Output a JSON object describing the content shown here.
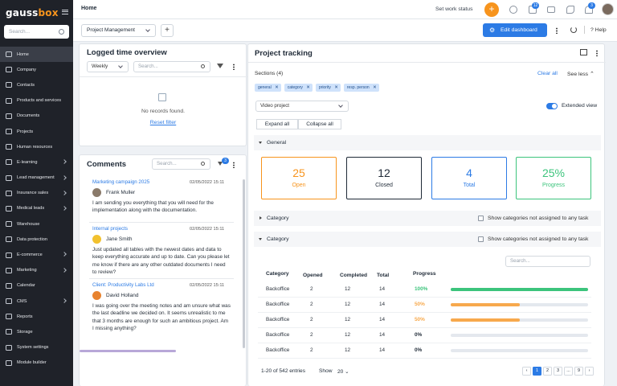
{
  "sidebar": {
    "logo_main": "gauss",
    "logo_accent": "box",
    "search_placeholder": "Search...",
    "items": [
      {
        "label": "Home",
        "active": true,
        "chevron": false
      },
      {
        "label": "Company",
        "chevron": false
      },
      {
        "label": "Contacts",
        "chevron": false
      },
      {
        "label": "Products and services",
        "chevron": false
      },
      {
        "label": "Documents",
        "chevron": false
      },
      {
        "label": "Projects",
        "chevron": false
      },
      {
        "label": "Human resources",
        "chevron": false
      },
      {
        "label": "E-learning",
        "chevron": true
      },
      {
        "label": "Lead management",
        "chevron": true
      },
      {
        "label": "Insurance sales",
        "chevron": true
      },
      {
        "label": "Medical leads",
        "chevron": true
      },
      {
        "label": "Warehouse",
        "chevron": false
      },
      {
        "label": "Data protection",
        "chevron": false
      },
      {
        "label": "E-commerce",
        "chevron": true
      },
      {
        "label": "Marketing",
        "chevron": true
      },
      {
        "label": "Calendar",
        "chevron": false
      },
      {
        "label": "CMS",
        "chevron": true
      },
      {
        "label": "Reports",
        "chevron": false
      },
      {
        "label": "Storage",
        "chevron": false
      },
      {
        "label": "System settings",
        "chevron": false
      },
      {
        "label": "Module builder",
        "chevron": false
      }
    ]
  },
  "topbar": {
    "breadcrumb": "Home",
    "set_work_status": "Set work status",
    "add_symbol": "+",
    "chat_badge": "12",
    "bell_badge": "3",
    "icons": [
      "star-icon",
      "chat-icon",
      "mail-icon",
      "phone-icon",
      "bell-icon"
    ]
  },
  "toolbar": {
    "dashboard_select": "Project Management",
    "add_symbol": "+",
    "edit_dashboard": "Edit dashboard",
    "help": "Help"
  },
  "logged_time": {
    "title": "Logged time overview",
    "period": "Weekly",
    "search_placeholder": "Search...",
    "empty_text": "No records found.",
    "reset_filter": "Reset filter"
  },
  "comments": {
    "title": "Comments",
    "search_placeholder": "Search...",
    "filter_badge": "3",
    "items": [
      {
        "title": "Marketing campaign 2025",
        "date": "02/05/2022 15:11",
        "user": "Frank Muller",
        "avatar_color": "#8a7a6a",
        "text": "I am sending you everything that you will need for the implementation along with the documentation."
      },
      {
        "title": "Internal projects",
        "date": "02/05/2022 15:11",
        "user": "Jane Smith",
        "avatar_color": "#f2c12e",
        "text": "Just updated all tables with the newest dates and data to keep everything accurate and up to date. Can you please let me know if there are any other outdated documents I need to review?"
      },
      {
        "title": "Client: Productivity Labs Ltd",
        "date": "02/05/2022 15:11",
        "user": "David Holland",
        "avatar_color": "#e8832f",
        "text": "I was going over the meeting notes and am unsure what was the last deadline we decided on. It seems unrealistic to me that 3 months are enough for such an ambitious project. Am I missing anything?"
      }
    ]
  },
  "tracking": {
    "title": "Project tracking",
    "sections_label": "Sections (4)",
    "clear_all": "Clear all",
    "see_less": "See less",
    "chips": [
      "general",
      "category",
      "priority",
      "resp. person"
    ],
    "project_select": "Video project",
    "extended_view": "Extended view",
    "expand_all": "Expand all",
    "collapse_all": "Collapse all",
    "general_label": "General",
    "stats": [
      {
        "value": "25",
        "label": "Open",
        "color": "#f7941d",
        "bg": "#ffffff"
      },
      {
        "value": "12",
        "label": "Closed",
        "color": "#1f2a37",
        "bg": "#ffffff"
      },
      {
        "value": "4",
        "label": "Total",
        "color": "#2c7be5",
        "bg": "#ffffff"
      },
      {
        "value": "25%",
        "label": "Progress",
        "color": "#3cc47c",
        "bg": "#ffffff"
      }
    ],
    "category_collapsed": "Category",
    "category_expanded": "Category",
    "show_unassigned": "Show categories not assigned to any task",
    "table_search_placeholder": "Search...",
    "columns": [
      "Category",
      "Opened",
      "Completed",
      "Total",
      "Progress"
    ],
    "rows": [
      {
        "category": "Backoffice",
        "opened": "2",
        "completed": "12",
        "total": "14",
        "progress_label": "100%",
        "progress": 1.0,
        "color": "#3cc47c"
      },
      {
        "category": "Backoffice",
        "opened": "2",
        "completed": "12",
        "total": "14",
        "progress_label": "50%",
        "progress": 0.5,
        "color": "#f7a94d"
      },
      {
        "category": "Backoffice",
        "opened": "2",
        "completed": "12",
        "total": "14",
        "progress_label": "50%",
        "progress": 0.5,
        "color": "#f7a94d"
      },
      {
        "category": "Backoffice",
        "opened": "2",
        "completed": "12",
        "total": "14",
        "progress_label": "0%",
        "progress": 0,
        "color": "#1f2a37"
      },
      {
        "category": "Backoffice",
        "opened": "2",
        "completed": "12",
        "total": "14",
        "progress_label": "0%",
        "progress": 0,
        "color": "#1f2a37"
      }
    ],
    "entries": "1-20 of 542 entries",
    "show_label": "Show",
    "page_size": "20",
    "pages": [
      "1",
      "2",
      "3",
      "...",
      "9"
    ],
    "current_page": "1",
    "prev": "‹",
    "next": "›"
  }
}
